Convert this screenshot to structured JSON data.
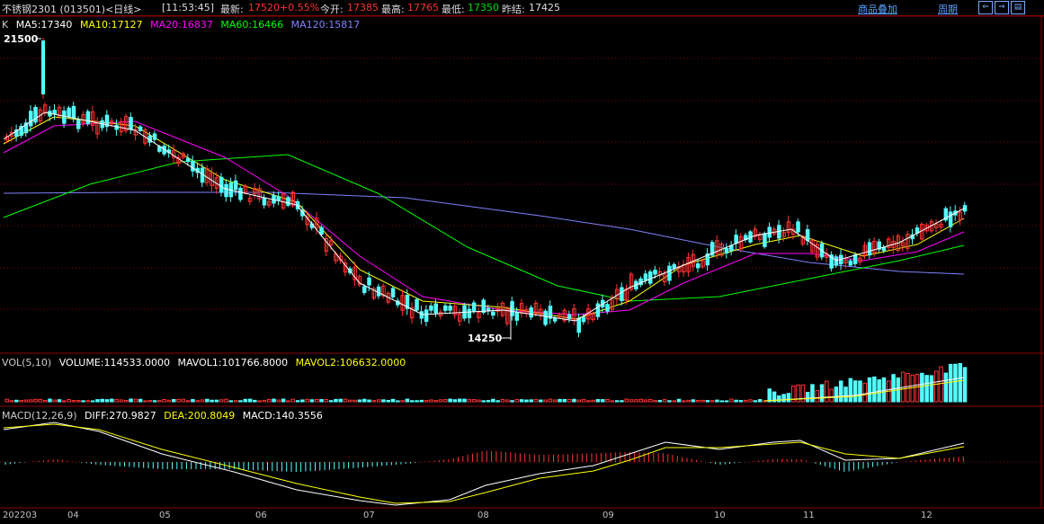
{
  "topbar": {
    "title": "不锈钢2301 (013501)<日线>",
    "time": "[11:53:45]",
    "latest_label": "最新:",
    "latest_value": "17520",
    "change": "+0.55%",
    "open_label": "今开:",
    "open_value": "17385",
    "high_label": "最高:",
    "high_value": "17765",
    "low_label": "最低:",
    "low_value": "17350",
    "prevclose_label": "昨结:",
    "prevclose_value": "17425",
    "overlay_link": "商品叠加",
    "period_link": "周期",
    "nav_buttons": [
      "⇐",
      "⇒",
      "▤"
    ]
  },
  "main_legend": {
    "k": "K",
    "ma5": "MA5:17340",
    "ma10": "MA10:17127",
    "ma20": "MA20:16837",
    "ma60": "MA60:16466",
    "ma120": "MA120:15817"
  },
  "price_marks": {
    "high": "21500",
    "low": "14250"
  },
  "vol_legend": {
    "vol": "VOL(5,10)",
    "volume": "VOLUME:114533.0000",
    "mavol1": "MAVOL1:101766.8000",
    "mavol2": "MAVOL2:106632.0000"
  },
  "macd_legend": {
    "macd_name": "MACD(12,26,9)",
    "diff": "DIFF:270.9827",
    "dea": "DEA:200.8049",
    "macd": "MACD:140.3556"
  },
  "x_axis": [
    "202203",
    "04",
    "05",
    "06",
    "07",
    "08",
    "09",
    "10",
    "11",
    "12"
  ],
  "colors": {
    "up": "#ff3232",
    "down": "#54ffff",
    "ma5": "#ffffff",
    "ma10": "#ffff00",
    "ma20": "#ff00ff",
    "ma60": "#00ff00",
    "ma120": "#8080ff",
    "grid": "#8b0000"
  }
}
